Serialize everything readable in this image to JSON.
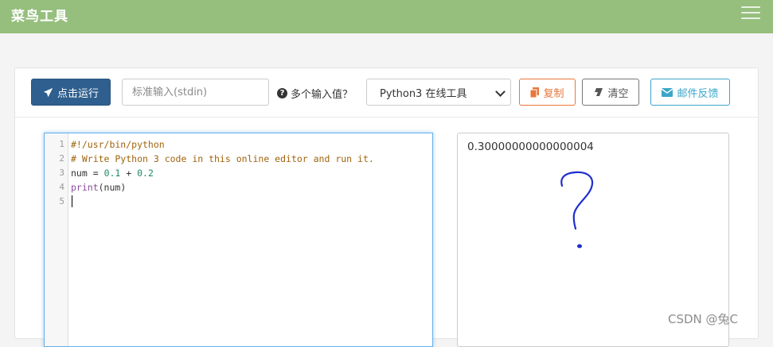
{
  "header": {
    "brand": "菜鸟工具",
    "menu_icon": "hamburger-icon"
  },
  "toolbar": {
    "run_label": "点击运行",
    "run_icon": "paper-plane-icon",
    "stdin_placeholder": "标准输入(stdin)",
    "help_label": "多个输入值？",
    "help_icon": "question-circle-icon",
    "language_selected": "Python3 在线工具",
    "copy_label": "复制",
    "clear_label": "清空",
    "feedback_label": "邮件反馈"
  },
  "editor": {
    "line_numbers": [
      "1",
      "2",
      "3",
      "4",
      "5"
    ],
    "lines": {
      "shebang": "#!/usr/bin/python",
      "comment": "# Write Python 3 code in this online editor and run it.",
      "l3_var": "num",
      "l3_eq": " = ",
      "l3_a": "0.1",
      "l3_plus": " + ",
      "l3_b": "0.2",
      "l4_fn": "print",
      "l4_args": "(num)"
    }
  },
  "output": {
    "text": "0.30000000000000004"
  },
  "watermark": "CSDN @兔C",
  "colors": {
    "header_bg": "#96bf7e",
    "run_btn": "#2f5f8e",
    "copy": "#e8773b",
    "feedback": "#3ba6c9",
    "annotation": "#1f2fcf"
  }
}
